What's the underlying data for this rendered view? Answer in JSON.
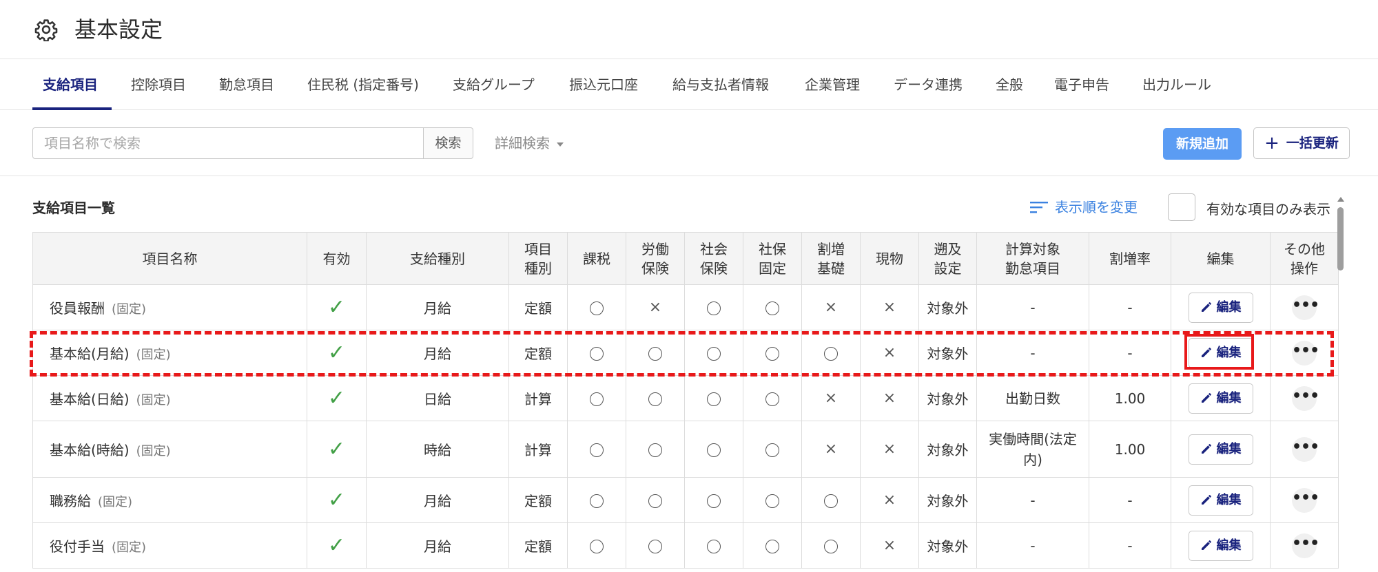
{
  "header": {
    "title": "基本設定",
    "icon": "gear-icon"
  },
  "tabs": [
    {
      "label": "支給項目",
      "active": true
    },
    {
      "label": "控除項目"
    },
    {
      "label": "勤怠項目"
    },
    {
      "label": "住民税 (指定番号)"
    },
    {
      "label": "支給グループ"
    },
    {
      "label": "振込元口座"
    },
    {
      "label": "給与支払者情報"
    },
    {
      "label": "企業管理"
    },
    {
      "label": "データ連携"
    },
    {
      "label": "全般"
    },
    {
      "label": "電子申告"
    },
    {
      "label": "出力ルール"
    }
  ],
  "search": {
    "placeholder": "項目名称で検索",
    "value": "",
    "button_label": "検索",
    "advanced_label": "詳細検索"
  },
  "actions": {
    "new_label": "新規追加",
    "bulk_label": "一括更新"
  },
  "list": {
    "title": "支給項目一覧",
    "reorder_label": "表示順を変更",
    "only_valid_label": "有効な項目のみ表示",
    "only_valid_checked": false
  },
  "table": {
    "headers": {
      "name": "項目名称",
      "valid": "有効",
      "pay_type": "支給種別",
      "item_type_1": "項目",
      "item_type_2": "種別",
      "tax": "課税",
      "labor_1": "労働",
      "labor_2": "保険",
      "social_1": "社会",
      "social_2": "保険",
      "shaho_1": "社保",
      "shaho_2": "固定",
      "premium_1": "割増",
      "premium_2": "基礎",
      "inkind": "現物",
      "retro_1": "遡及",
      "retro_2": "設定",
      "calc_1": "計算対象",
      "calc_2": "勤怠項目",
      "rate": "割増率",
      "edit": "編集",
      "other_1": "その他",
      "other_2": "操作"
    },
    "edit_label": "編集",
    "more_label": "•••",
    "check_mark": "✓",
    "circle_mark": "○",
    "cross_mark": "×",
    "fixed_suffix": "(固定)",
    "rows": [
      {
        "name": "役員報酬",
        "pay_type": "月給",
        "item_type": "定額",
        "tax": "○",
        "labor": "×",
        "social": "○",
        "shaho": "○",
        "premium": "×",
        "inkind": "×",
        "retro": "対象外",
        "calc": "-",
        "rate": "-"
      },
      {
        "name": "基本給(月給)",
        "pay_type": "月給",
        "item_type": "定額",
        "tax": "○",
        "labor": "○",
        "social": "○",
        "shaho": "○",
        "premium": "○",
        "inkind": "×",
        "retro": "対象外",
        "calc": "-",
        "rate": "-"
      },
      {
        "name": "基本給(日給)",
        "pay_type": "日給",
        "item_type": "計算",
        "tax": "○",
        "labor": "○",
        "social": "○",
        "shaho": "○",
        "premium": "×",
        "inkind": "×",
        "retro": "対象外",
        "calc": "出勤日数",
        "rate": "1.00"
      },
      {
        "name": "基本給(時給)",
        "pay_type": "時給",
        "item_type": "計算",
        "tax": "○",
        "labor": "○",
        "social": "○",
        "shaho": "○",
        "premium": "×",
        "inkind": "×",
        "retro": "対象外",
        "calc": "実働時間(法定内)",
        "rate": "1.00"
      },
      {
        "name": "職務給",
        "pay_type": "月給",
        "item_type": "定額",
        "tax": "○",
        "labor": "○",
        "social": "○",
        "shaho": "○",
        "premium": "○",
        "inkind": "×",
        "retro": "対象外",
        "calc": "-",
        "rate": "-"
      },
      {
        "name": "役付手当",
        "pay_type": "月給",
        "item_type": "定額",
        "tax": "○",
        "labor": "○",
        "social": "○",
        "shaho": "○",
        "premium": "○",
        "inkind": "×",
        "retro": "対象外",
        "calc": "-",
        "rate": "-"
      }
    ]
  },
  "highlight": {
    "color": "#e8191a"
  },
  "colors": {
    "accent": "#1a237e",
    "primary_button": "#5b9cf3",
    "link": "#3b82e0",
    "check": "#43a047"
  }
}
